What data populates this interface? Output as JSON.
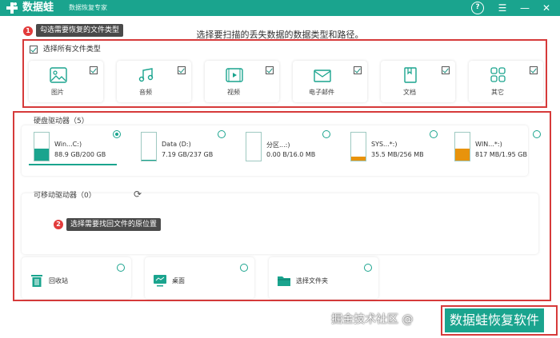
{
  "titlebar": {
    "app_name": "数据蛙",
    "subtitle": "数据恢复专家",
    "brand_color": "#1aa48e",
    "controls": [
      "help-icon",
      "menu-icon",
      "minimize-icon",
      "close-icon"
    ]
  },
  "heading": "选择要扫描的丢失数据的数据类型和路径。",
  "step1": {
    "badge": "1",
    "tip": "勾选需要恢复的文件类型"
  },
  "file_types": {
    "select_all_label": "选择所有文件类型",
    "select_all_checked": true,
    "items": [
      {
        "label": "图片",
        "icon": "image-icon",
        "checked": true
      },
      {
        "label": "音频",
        "icon": "music-icon",
        "checked": true
      },
      {
        "label": "视频",
        "icon": "video-icon",
        "checked": true
      },
      {
        "label": "电子邮件",
        "icon": "email-icon",
        "checked": true
      },
      {
        "label": "文档",
        "icon": "document-icon",
        "checked": true
      },
      {
        "label": "其它",
        "icon": "other-icon",
        "checked": true
      }
    ]
  },
  "hard_drives": {
    "title": "硬盘驱动器（5）",
    "drives": [
      {
        "name": "Win...C:)",
        "size": "88.9 GB/200 GB",
        "used_fraction": 0.44,
        "fill_color": "#1aa48e",
        "selected": true
      },
      {
        "name": "Data (D:)",
        "size": "7.19 GB/237 GB",
        "used_fraction": 0.03,
        "fill_color": "#1aa48e",
        "selected": false
      },
      {
        "name": "分区...:)",
        "size": "0.00  B/16.0 MB",
        "used_fraction": 0.0,
        "fill_color": "#e0c89a",
        "selected": false
      },
      {
        "name": "SYS...*:)",
        "size": "35.5 MB/256 MB",
        "used_fraction": 0.14,
        "fill_color": "#e8930c",
        "selected": false
      },
      {
        "name": "WIN...*:)",
        "size": "817 MB/1.95 GB",
        "used_fraction": 0.42,
        "fill_color": "#e8930c",
        "selected": false
      }
    ]
  },
  "removable": {
    "title": "可移动驱动器（0）",
    "refresh_icon": "refresh-icon"
  },
  "step2": {
    "badge": "2",
    "tip": "选择需要找回文件的原位置"
  },
  "locations": [
    {
      "label": "回收站",
      "icon": "recycle-bin-icon"
    },
    {
      "label": "桌面",
      "icon": "desktop-icon"
    },
    {
      "label": "选择文件夹",
      "icon": "folder-icon"
    }
  ],
  "watermark": {
    "left_text": "掘金技术社区 @",
    "right_text": "数据蛙恢复软件"
  }
}
